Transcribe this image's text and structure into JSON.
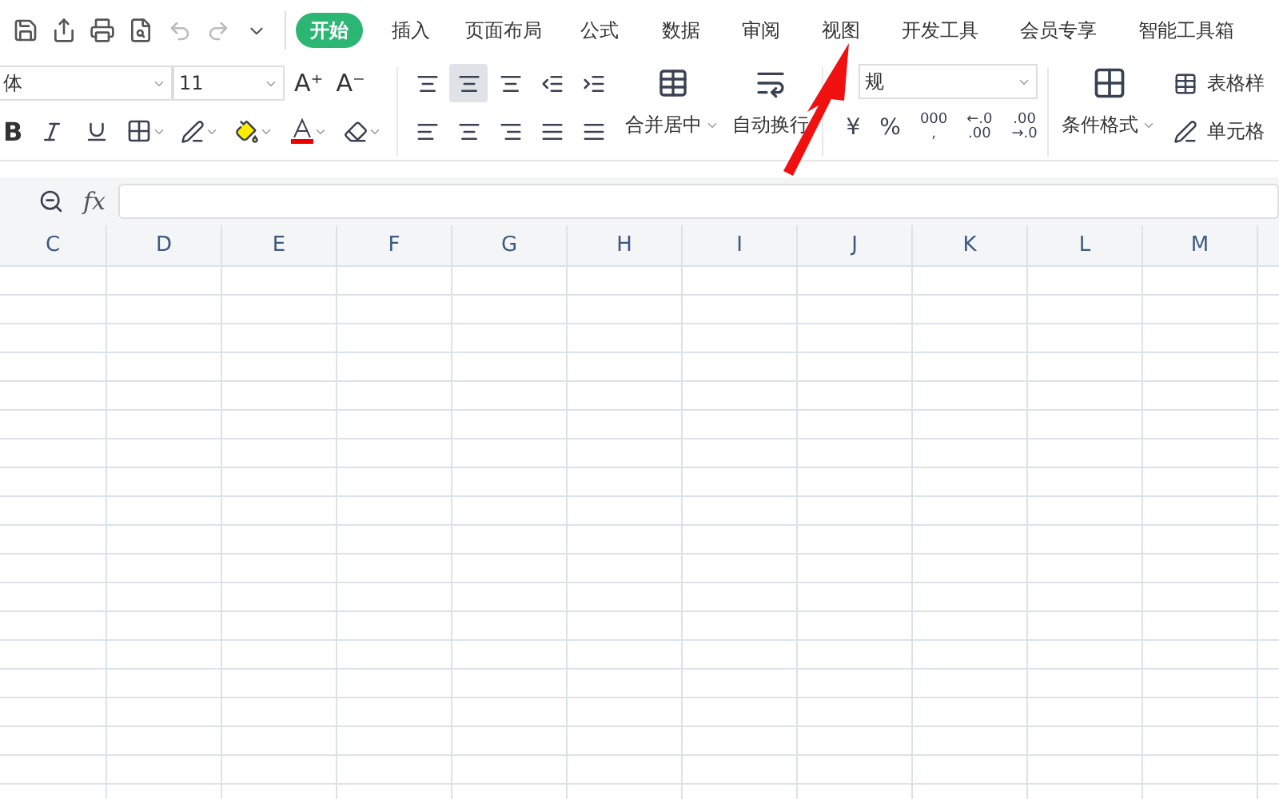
{
  "tabs": [
    {
      "label": "开始",
      "selected": true
    },
    {
      "label": "插入",
      "selected": false
    },
    {
      "label": "页面布局",
      "selected": false
    },
    {
      "label": "公式",
      "selected": false
    },
    {
      "label": "数据",
      "selected": false
    },
    {
      "label": "审阅",
      "selected": false
    },
    {
      "label": "视图",
      "selected": false
    },
    {
      "label": "开发工具",
      "selected": false
    },
    {
      "label": "会员专享",
      "selected": false
    },
    {
      "label": "智能工具箱",
      "selected": false
    }
  ],
  "font": {
    "name": "体",
    "size": "11"
  },
  "font_size_buttons": [
    "A⁺",
    "A⁻"
  ],
  "bold_label": "B",
  "merge_button": "合并居中",
  "wrap_button": "自动换行",
  "number_format": "规",
  "number_buttons": [
    "¥",
    "%",
    "000\n,",
    "←.0\n.00",
    ".00\n→.0"
  ],
  "conditional_button": "条件格式",
  "table_style_button": "表格样",
  "cell_style_button": "单元格",
  "formula_bar": {
    "fx": "fx"
  },
  "columns": [
    "C",
    "D",
    "E",
    "F",
    "G",
    "H",
    "I",
    "J",
    "K",
    "L",
    "M"
  ]
}
